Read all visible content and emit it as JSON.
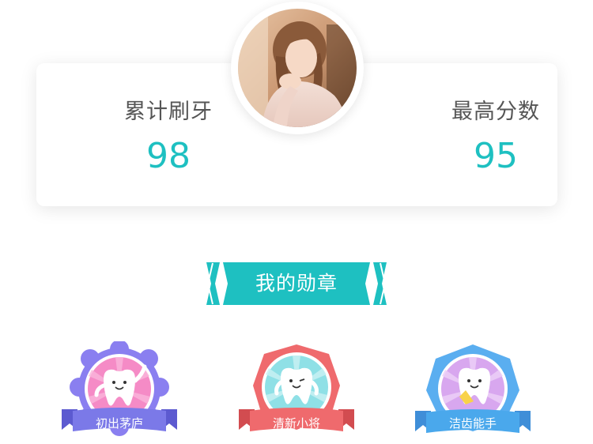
{
  "stats": {
    "total_brushing_label": "累计刷牙",
    "total_brushing_value": "98",
    "best_score_label": "最高分数",
    "best_score_value": "95"
  },
  "medals_section": {
    "title": "我的勋章"
  },
  "badges": [
    {
      "label": "初出茅庐",
      "color": "#7b79e8"
    },
    {
      "label": "清新小将",
      "color": "#ef6a6d"
    },
    {
      "label": "洁齿能手",
      "color": "#4aa8ec"
    }
  ],
  "colors": {
    "accent": "#1ec0c1"
  }
}
